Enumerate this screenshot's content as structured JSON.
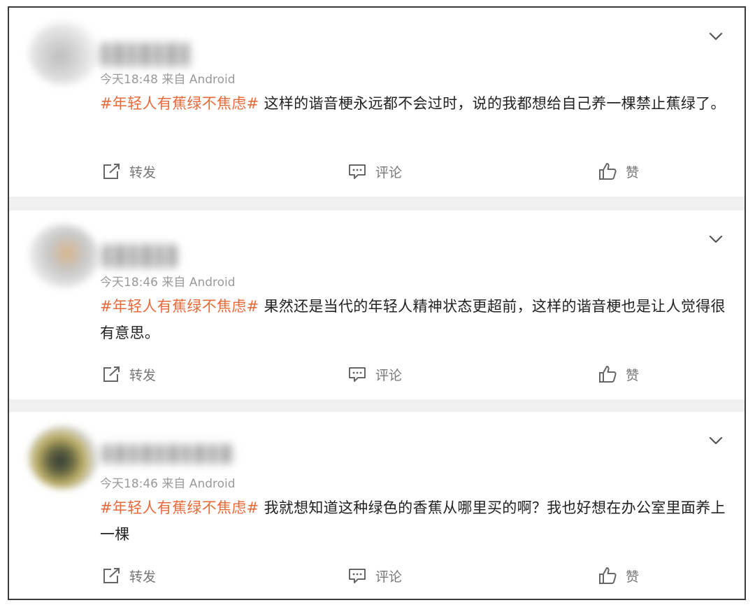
{
  "posts": [
    {
      "time": "今天18:48",
      "source": "来自 Android",
      "topic": "#年轻人有蕉绿不焦虑#",
      "text": " 这样的谐音梗永远都不会过时，说的我都想给自己养一棵禁止蕉绿了。",
      "actions": {
        "forward": "转发",
        "comment": "评论",
        "like": "赞"
      }
    },
    {
      "time": "今天18:46",
      "source": "来自 Android",
      "topic": "#年轻人有蕉绿不焦虑#",
      "text": " 果然还是当代的年轻人精神状态更超前，这样的谐音梗也是让人觉得很有意思。",
      "actions": {
        "forward": "转发",
        "comment": "评论",
        "like": "赞"
      }
    },
    {
      "time": "今天18:46",
      "source": "来自 Android",
      "topic": "#年轻人有蕉绿不焦虑#",
      "text": " 我就想知道这种绿色的香蕉从哪里买的啊？我也好想在办公室里面养上一棵",
      "actions": {
        "forward": "转发",
        "comment": "评论",
        "like": "赞"
      }
    }
  ],
  "colors": {
    "topic": "#e86a3a",
    "meta": "#9a9a9a",
    "separator": "#f0f0f0"
  },
  "icons": [
    "chevron-down-icon",
    "forward-icon",
    "comment-icon",
    "like-icon"
  ]
}
